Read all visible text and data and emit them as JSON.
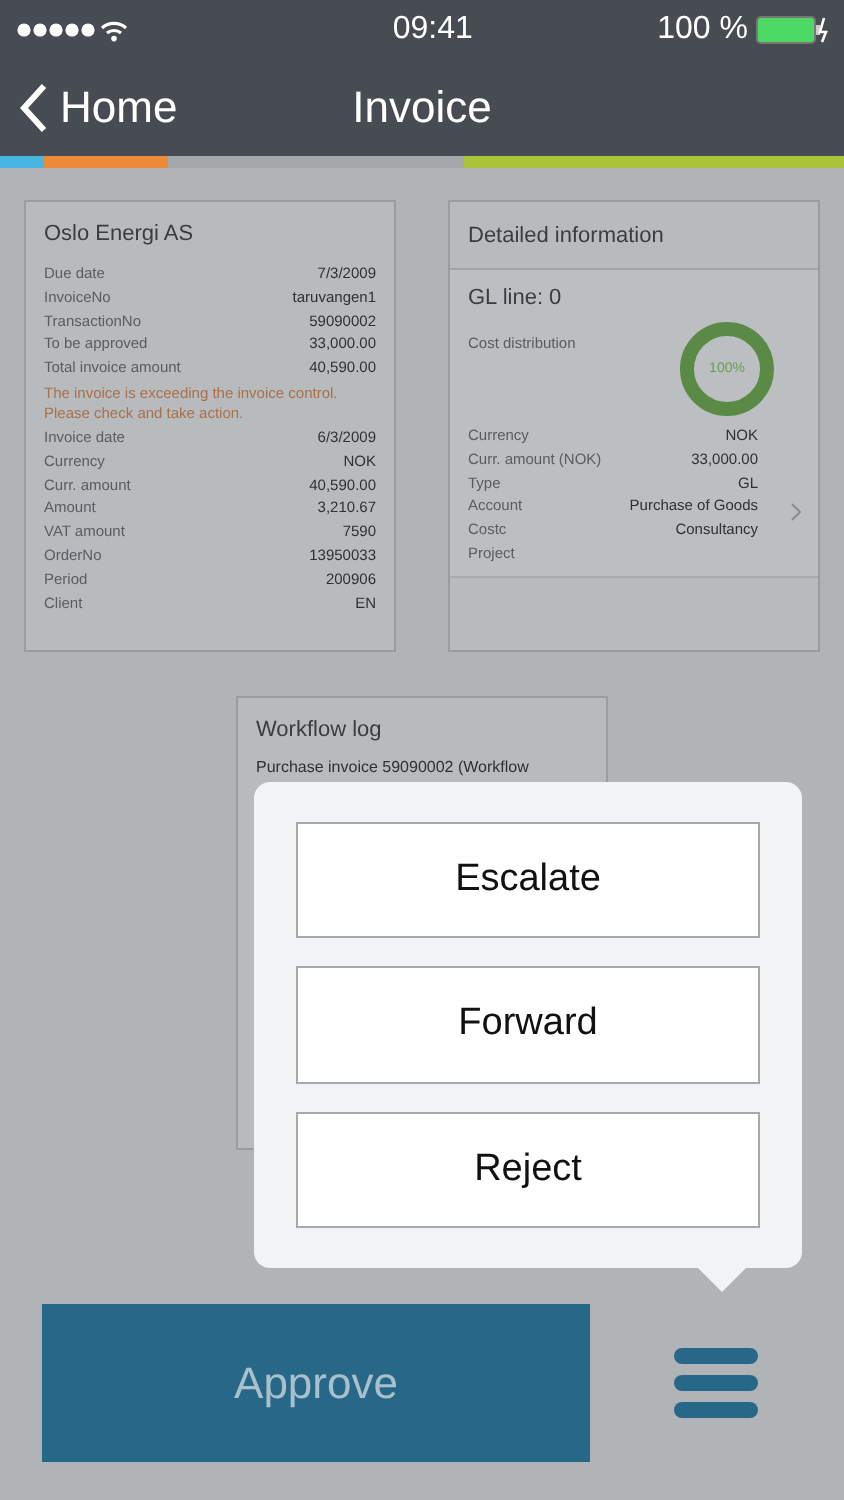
{
  "status_bar": {
    "time": "09:41",
    "battery": "100 %"
  },
  "nav": {
    "back": "Home",
    "title": "Invoice"
  },
  "invoice_card": {
    "title": "Oslo Energi AS",
    "rows": [
      {
        "label": "Due date",
        "value": "7/3/2009"
      },
      {
        "label": "InvoiceNo",
        "value": "taruvangen1"
      },
      {
        "label": "TransactionNo",
        "value": "59090002"
      },
      {
        "label": "To be approved",
        "value": "33,000.00"
      },
      {
        "label": "Total invoice amount",
        "value": "40,590.00"
      }
    ],
    "warning": "The invoice is exceeding the invoice control. Please check and take action.",
    "rows_2": [
      {
        "label": "Invoice date",
        "value": "6/3/2009"
      },
      {
        "label": "Currency",
        "value": "NOK"
      },
      {
        "label": "Curr. amount",
        "value": "40,590.00"
      },
      {
        "label": "Amount",
        "value": "3,210.67"
      },
      {
        "label": "VAT amount",
        "value": "7590"
      },
      {
        "label": "OrderNo",
        "value": "13950033"
      },
      {
        "label": "Period",
        "value": "200906"
      },
      {
        "label": "Client",
        "value": "EN"
      }
    ]
  },
  "detail_card": {
    "title": "Detailed information",
    "gl_line": "GL line: 0",
    "cost_label": "Cost distribution",
    "cost_percent": "100%",
    "rows": [
      {
        "label": "Currency",
        "value": "NOK"
      },
      {
        "label": "Curr. amount (NOK)",
        "value": "33,000.00"
      },
      {
        "label": "Type",
        "value": "GL"
      },
      {
        "label": "Account",
        "value": "Purchase of Goods"
      },
      {
        "label": "Costc",
        "value": "Consultancy"
      },
      {
        "label": "Project",
        "value": ""
      }
    ]
  },
  "workflow_card": {
    "title": "Workflow log",
    "text": "Purchase invoice 59090002 (Workflow"
  },
  "action_menu": [
    "Escalate",
    "Forward",
    "Reject"
  ],
  "approve_button": "Approve"
}
